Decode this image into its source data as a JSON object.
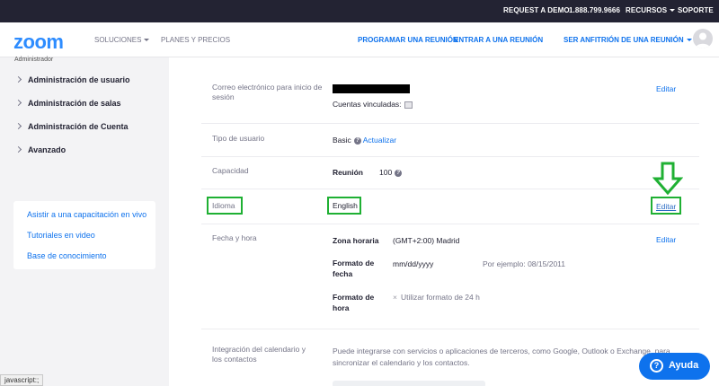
{
  "topbar": {
    "request_demo": "REQUEST A DEMO",
    "phone": "1.888.799.9666",
    "resources": "RECURSOS",
    "support": "SOPORTE"
  },
  "header": {
    "logo": "zoom",
    "solutions": "SOLUCIONES",
    "plans": "PLANES Y PRECIOS",
    "schedule": "PROGRAMAR UNA REUNIÓN",
    "join": "ENTRAR A UNA REUNIÓN",
    "host": "SER ANFITRIÓN DE UNA REUNIÓN"
  },
  "sidebar": {
    "cut_label": "Administrador",
    "items": [
      {
        "label": "Administración de usuario"
      },
      {
        "label": "Administración de salas"
      },
      {
        "label": "Administración de Cuenta"
      },
      {
        "label": "Avanzado"
      }
    ],
    "links": [
      {
        "label": "Asistir a una capacitación en vivo"
      },
      {
        "label": "Tutoriales en video"
      },
      {
        "label": "Base de conocimiento"
      }
    ]
  },
  "profile": {
    "email": {
      "label": "Correo electrónico para inicio de sesión",
      "linked": "Cuentas vinculadas:",
      "edit": "Editar"
    },
    "user_type": {
      "label": "Tipo de usuario",
      "value": "Basic",
      "upgrade": "Actualizar"
    },
    "capacity": {
      "label": "Capacidad",
      "meeting_label": "Reunión",
      "meeting_value": "100"
    },
    "language": {
      "label": "Idioma",
      "value": "English",
      "edit": "Editar"
    },
    "datetime": {
      "label": "Fecha y hora",
      "timezone_label": "Zona horaria",
      "timezone_value": "(GMT+2:00) Madrid",
      "date_format_label_1": "Formato de",
      "date_format_label_2": "fecha",
      "date_format_value": "mm/dd/yyyy",
      "date_example": "Por ejemplo: 08/15/2011",
      "time_format_label_1": "Formato de",
      "time_format_label_2": "hora",
      "time_format_value": "Utilizar formato de 24 h",
      "edit": "Editar"
    },
    "calendar": {
      "label_1": "Integración del calendario y",
      "label_2": "los contactos",
      "text_1": "Puede integrarse con servicios o aplicaciones de terceros, como Google, Outlook o Exchange, para",
      "text_2": "sincronizar el calendario y los contactos."
    }
  },
  "help_button": "Ayuda",
  "status_bar": "javascript:;",
  "colors": {
    "accent": "#0e72ed",
    "highlight": "#1fb033",
    "topbar": "#232333"
  }
}
